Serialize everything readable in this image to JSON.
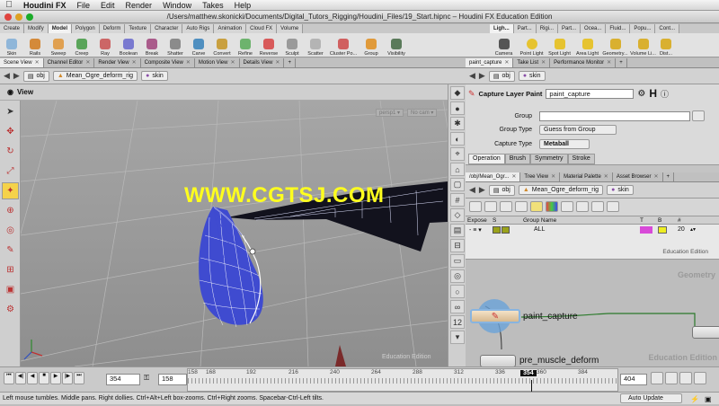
{
  "menubar": {
    "app": "Houdini FX",
    "items": [
      "File",
      "Edit",
      "Render",
      "Window",
      "Takes",
      "Help"
    ]
  },
  "window": {
    "title": "/Users/matthew.skonicki/Documents/Digital_Tutors_Rigging/Houdini_Files/19_Start.hipnc – Houdini FX Education Edition"
  },
  "shelf": {
    "tabs": [
      "Create",
      "Modify",
      "Model",
      "Polygon",
      "Deform",
      "Texture",
      "Character",
      "Auto Rigs",
      "Animation",
      "Cloud FX",
      "Volume"
    ],
    "active_tab": "Model",
    "tools": [
      "Skin",
      "Rails",
      "Sweep",
      "Creep",
      "Ray",
      "Boolean",
      "Break",
      "Shatter",
      "Carve",
      "Convert",
      "Refine",
      "Reverse",
      "Sculpt",
      "Scatter",
      "Cluster Po...",
      "Group",
      "Visibility"
    ]
  },
  "light_shelf": {
    "tabs": [
      "Ligh...",
      "Part...",
      "Rigi...",
      "Part...",
      "Ocea...",
      "Fluid...",
      "Popu...",
      "Cont..."
    ],
    "tools": [
      "Camera",
      "Point Light",
      "Spot Light",
      "Area Light",
      "Geometry...",
      "Volume Li...",
      "Dist..."
    ]
  },
  "pane_tabs": [
    "Scene View",
    "Channel Editor",
    "Render View",
    "Composite View",
    "Motion View",
    "Details View"
  ],
  "path": {
    "root": "obj",
    "node": "Mean_Ogre_deform_rig",
    "leaf": "skin"
  },
  "viewport": {
    "title": "View",
    "persp": "persp1 ▾",
    "cam": "No cam ▾",
    "watermark_center": "WWW.CGTSJ.COM",
    "edition": "Education Edition"
  },
  "timeline": {
    "current_frame": "354",
    "start_frame": "1",
    "end_field": "158",
    "ticks": [
      "158",
      "168",
      "192",
      "216",
      "240",
      "264",
      "288",
      "312",
      "336",
      "360",
      "384"
    ],
    "playhead": "354",
    "end_frame": "404",
    "update_mode": "Auto Update"
  },
  "status": {
    "text": "Left mouse tumbles. Middle pans. Right dollies. Ctrl+Alt+Left box-zooms. Ctrl+Right zooms. Spacebar-Ctrl-Left tilts."
  },
  "param_pane": {
    "tabs": [
      "paint_capture",
      "Take List",
      "Performance Monitor"
    ],
    "crumb_root": "obj",
    "crumb_leaf": "skin",
    "node_type": "Capture Layer Paint",
    "node_name": "paint_capture",
    "rows": [
      {
        "label": "Group",
        "value": ""
      },
      {
        "label": "Group Type",
        "value": "Guess from Group"
      },
      {
        "label": "Capture Type",
        "value": "Metaball"
      }
    ],
    "subtabs": [
      "Operation",
      "Brush",
      "Symmetry",
      "Stroke"
    ]
  },
  "net_pane": {
    "tabs": [
      "/obj/Mean_Ogr...",
      "Tree View",
      "Material Palette",
      "Asset Browser"
    ],
    "crumb_root": "obj",
    "crumb_node": "Mean_Ogre_deform_rig",
    "crumb_leaf": "skin",
    "table_headers": [
      "Expose",
      "S",
      "Group Name",
      "T",
      "B",
      "#"
    ],
    "table_row": {
      "group": "ALL",
      "count": "20"
    },
    "table_edition": "Education Edition",
    "geometry_label": "Geometry",
    "node_main": "paint_capture",
    "node_second": "pre_muscle_deform",
    "edition": "Education Edition"
  },
  "colors": {
    "wire": "#1e2f8c",
    "shell": "#3f4bd0",
    "dark_band": "#12121d",
    "watermark": "#ffff1e"
  }
}
